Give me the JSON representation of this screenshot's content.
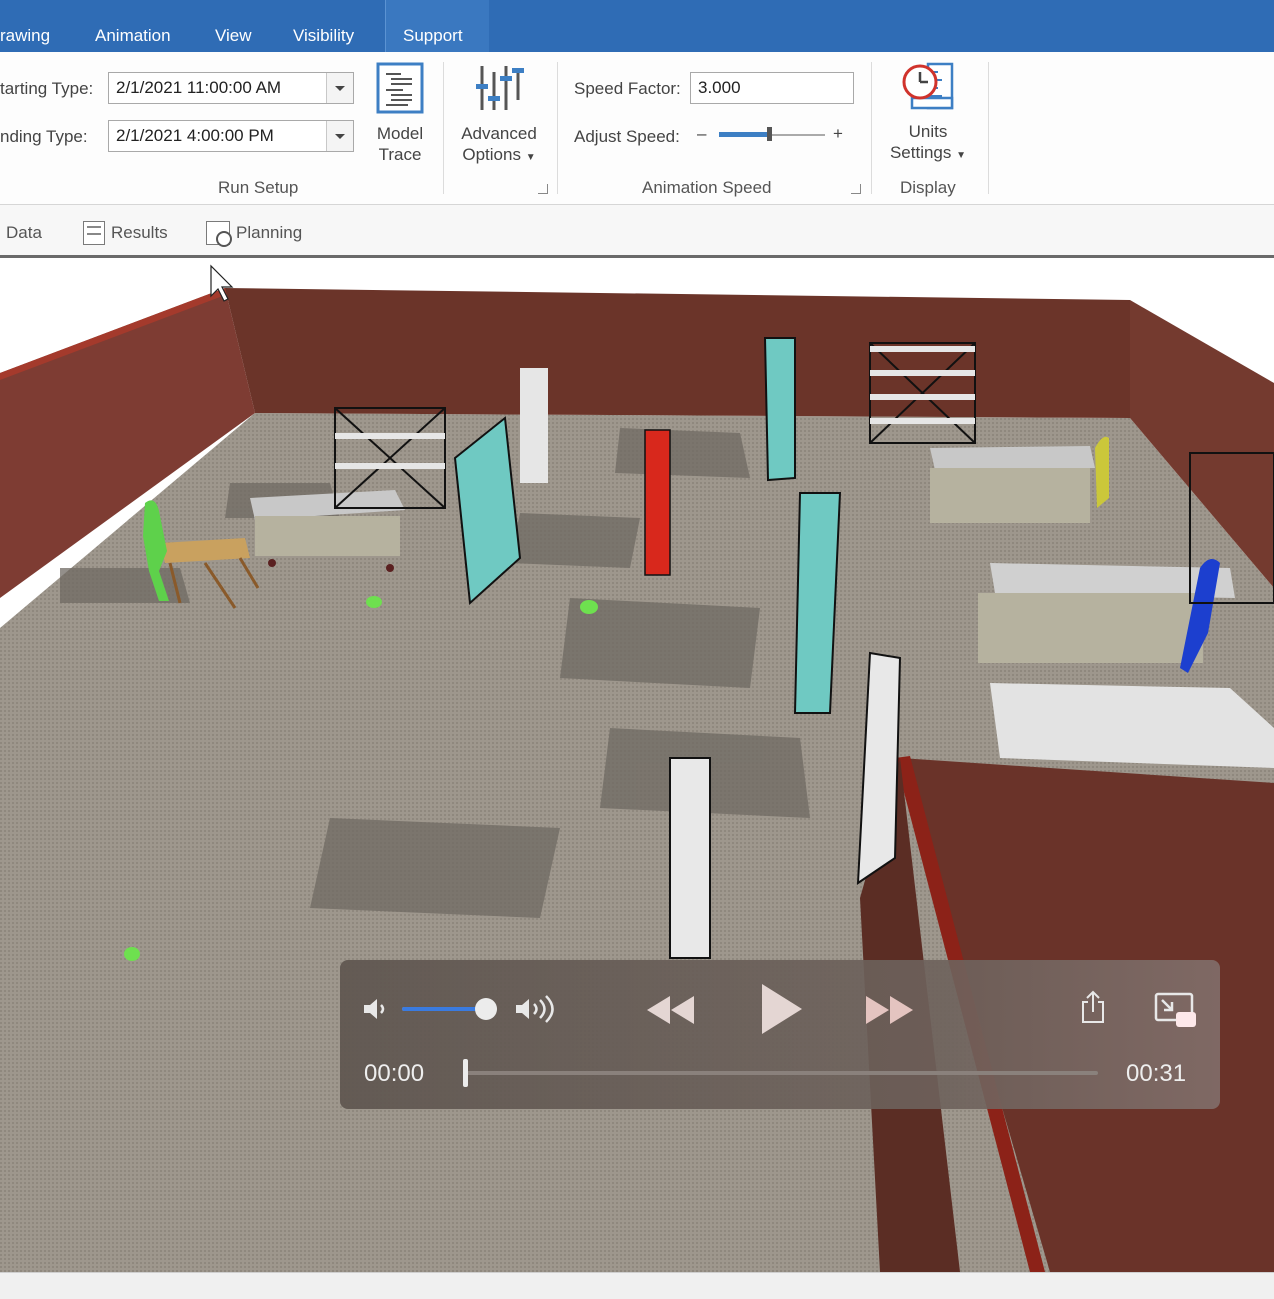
{
  "ribbon_tabs": [
    "rawing",
    "Animation",
    "View",
    "Visibility",
    "Support"
  ],
  "run_setup": {
    "starting_label": "tarting Type:",
    "starting_value": "2/1/2021 11:00:00 AM",
    "ending_label": "nding Type:",
    "ending_value": "2/1/2021 4:00:00 PM",
    "model_trace_label_1": "Model",
    "model_trace_label_2": "Trace",
    "advanced_label_1": "Advanced",
    "advanced_label_2": "Options",
    "group_label": "Run Setup"
  },
  "animation_speed": {
    "speed_factor_label": "Speed Factor:",
    "speed_factor_value": "3.000",
    "adjust_speed_label": "Adjust Speed:",
    "minus": "–",
    "plus": "+",
    "group_label": "Animation Speed"
  },
  "display": {
    "units_label_1": "Units",
    "units_label_2": "Settings",
    "group_label": "Display"
  },
  "subbar": [
    "Data",
    "Results",
    "Planning"
  ],
  "player": {
    "current_time": "00:00",
    "total_time": "00:31",
    "volume_fraction": 0.88,
    "progress_fraction": 0.0
  }
}
